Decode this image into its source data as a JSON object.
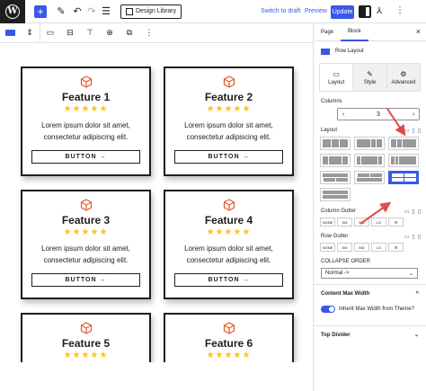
{
  "toolbar": {
    "wp_logo": "W",
    "add": "+",
    "edit": "✎",
    "undo": "↶",
    "redo": "↷",
    "list_view": "☰",
    "design_library": "Design Library",
    "switch_to_draft": "Switch to draft",
    "preview": "Preview",
    "update": "Update",
    "kadence_icon": "⅄",
    "more": "⋮"
  },
  "block_toolbar": {
    "items": [
      "row-layout-icon",
      "chevron-updown-icon",
      "align-icon",
      "align-wide-icon",
      "pin-icon",
      "plus-circle-icon",
      "copy-icon",
      "more-icon"
    ]
  },
  "cards": [
    {
      "title": "Feature 1",
      "stars": "★★★★★",
      "text": "Lorem ipsum dolor sit amet, consectetur adipiscing elit.",
      "button": "BUTTON →"
    },
    {
      "title": "Feature 2",
      "stars": "★★★★★",
      "text": "Lorem ipsum dolor sit amet, consectetur adipiscing elit.",
      "button": "BUTTON →"
    },
    {
      "title": "Feature 3",
      "stars": "★★★★★",
      "text": "Lorem ipsum dolor sit amet, consectetur adipiscing elit.",
      "button": "BUTTON →"
    },
    {
      "title": "Feature 4",
      "stars": "★★★★★",
      "text": "Lorem ipsum dolor sit amet, consectetur adipiscing elit.",
      "button": "BUTTON →"
    },
    {
      "title": "Feature 5",
      "stars": "★★★★★",
      "text": "",
      "button": ""
    },
    {
      "title": "Feature 6",
      "stars": "★★★★★",
      "text": "",
      "button": ""
    }
  ],
  "sidebar": {
    "tab_page": "Page",
    "tab_block": "Block",
    "close": "×",
    "block_name": "Row Layout",
    "kt_tabs": [
      {
        "label": "Layout",
        "icon": "▭"
      },
      {
        "label": "Style",
        "icon": "✎"
      },
      {
        "label": "Advanced",
        "icon": "⚙"
      }
    ],
    "columns_label": "Columns",
    "columns_value": "3",
    "layout_label": "Layout",
    "column_gutter_label": "Column Gutter",
    "row_gutter_label": "Row Gutter",
    "gutter_options": [
      "NONE",
      "SM",
      "MD",
      "LG",
      "⚙"
    ],
    "collapse_order_label": "COLLAPSE ORDER",
    "collapse_order_value": "Normal ->",
    "content_max_width": "Content Max Width",
    "inherit_max_width": "Inherit Max Width from Theme?",
    "top_divider": "Top Divider",
    "chevron": "^"
  },
  "colors": {
    "accent": "#3858e9",
    "star": "#f7c325",
    "icon": "#e2582b",
    "arrow": "#e04c4c"
  }
}
